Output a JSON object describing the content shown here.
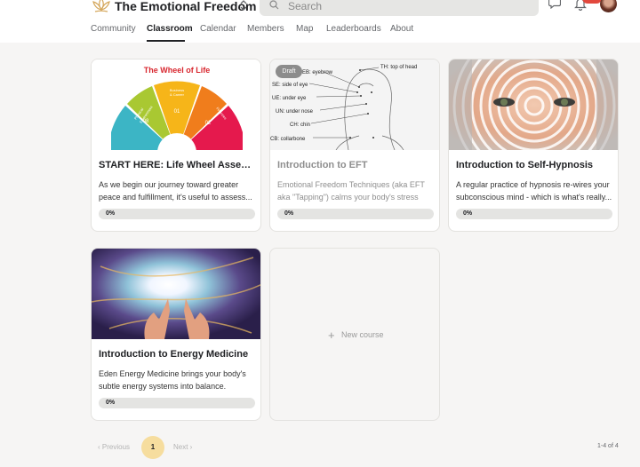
{
  "header": {
    "club_name": "The Emotional Freedom Club",
    "search_placeholder": "Search",
    "notification_count": ""
  },
  "nav": {
    "tabs": [
      {
        "label": "Community"
      },
      {
        "label": "Classroom",
        "active": true
      },
      {
        "label": "Calendar"
      },
      {
        "label": "Members"
      },
      {
        "label": "Map"
      },
      {
        "label": "Leaderboards"
      },
      {
        "label": "About"
      }
    ]
  },
  "courses": [
    {
      "title": "START HERE: Life Wheel Assess...",
      "description": "As we begin our journey toward greater peace and fulfillment, it's useful to assess...",
      "progress": "0%",
      "progress_value": 0,
      "image": {
        "heading": "The Wheel of Life",
        "segments": [
          {
            "label": "Physical Environment",
            "num": "08",
            "color": "#a9c832"
          },
          {
            "label": "Business & Career",
            "num": "01",
            "color": "#f6b519"
          },
          {
            "label": "Finances",
            "num": "02",
            "color": "#f07d1c"
          },
          {
            "label": "Health",
            "num": "03",
            "color": "#e5194d"
          },
          {
            "label": "",
            "num": "07",
            "color": "#3cb5c5"
          }
        ]
      }
    },
    {
      "title": "Introduction to EFT",
      "description": "Emotional Freedom Techniques (aka EFT aka \"Tapping\") calms your body's stress respon...",
      "progress": "0%",
      "progress_value": 0,
      "draft_label": "Draft",
      "image": {
        "points": [
          "EB: eyebrow",
          "SE: side of eye",
          "UE: under eye",
          "UN: under nose",
          "CH: chin",
          "CB: collarbone",
          "TH: top of head"
        ]
      }
    },
    {
      "title": "Introduction to Self-Hypnosis",
      "description": "A regular practice of hypnosis re-wires your subconscious mind - which is what's really...",
      "progress": "0%",
      "progress_value": 0
    },
    {
      "title": "Introduction to Energy Medicine",
      "description": "Eden Energy Medicine brings your body's subtle energy systems into balance. Create...",
      "progress": "0%",
      "progress_value": 0
    }
  ],
  "new_course": {
    "label": "New course"
  },
  "pagination": {
    "prev": "Previous",
    "next": "Next",
    "current_page": "1",
    "count": "1-4 of 4"
  },
  "colors": {
    "active_page": "#f6dd9e",
    "badge": "#e2483d",
    "draft_badge": "#8c8c8c"
  }
}
